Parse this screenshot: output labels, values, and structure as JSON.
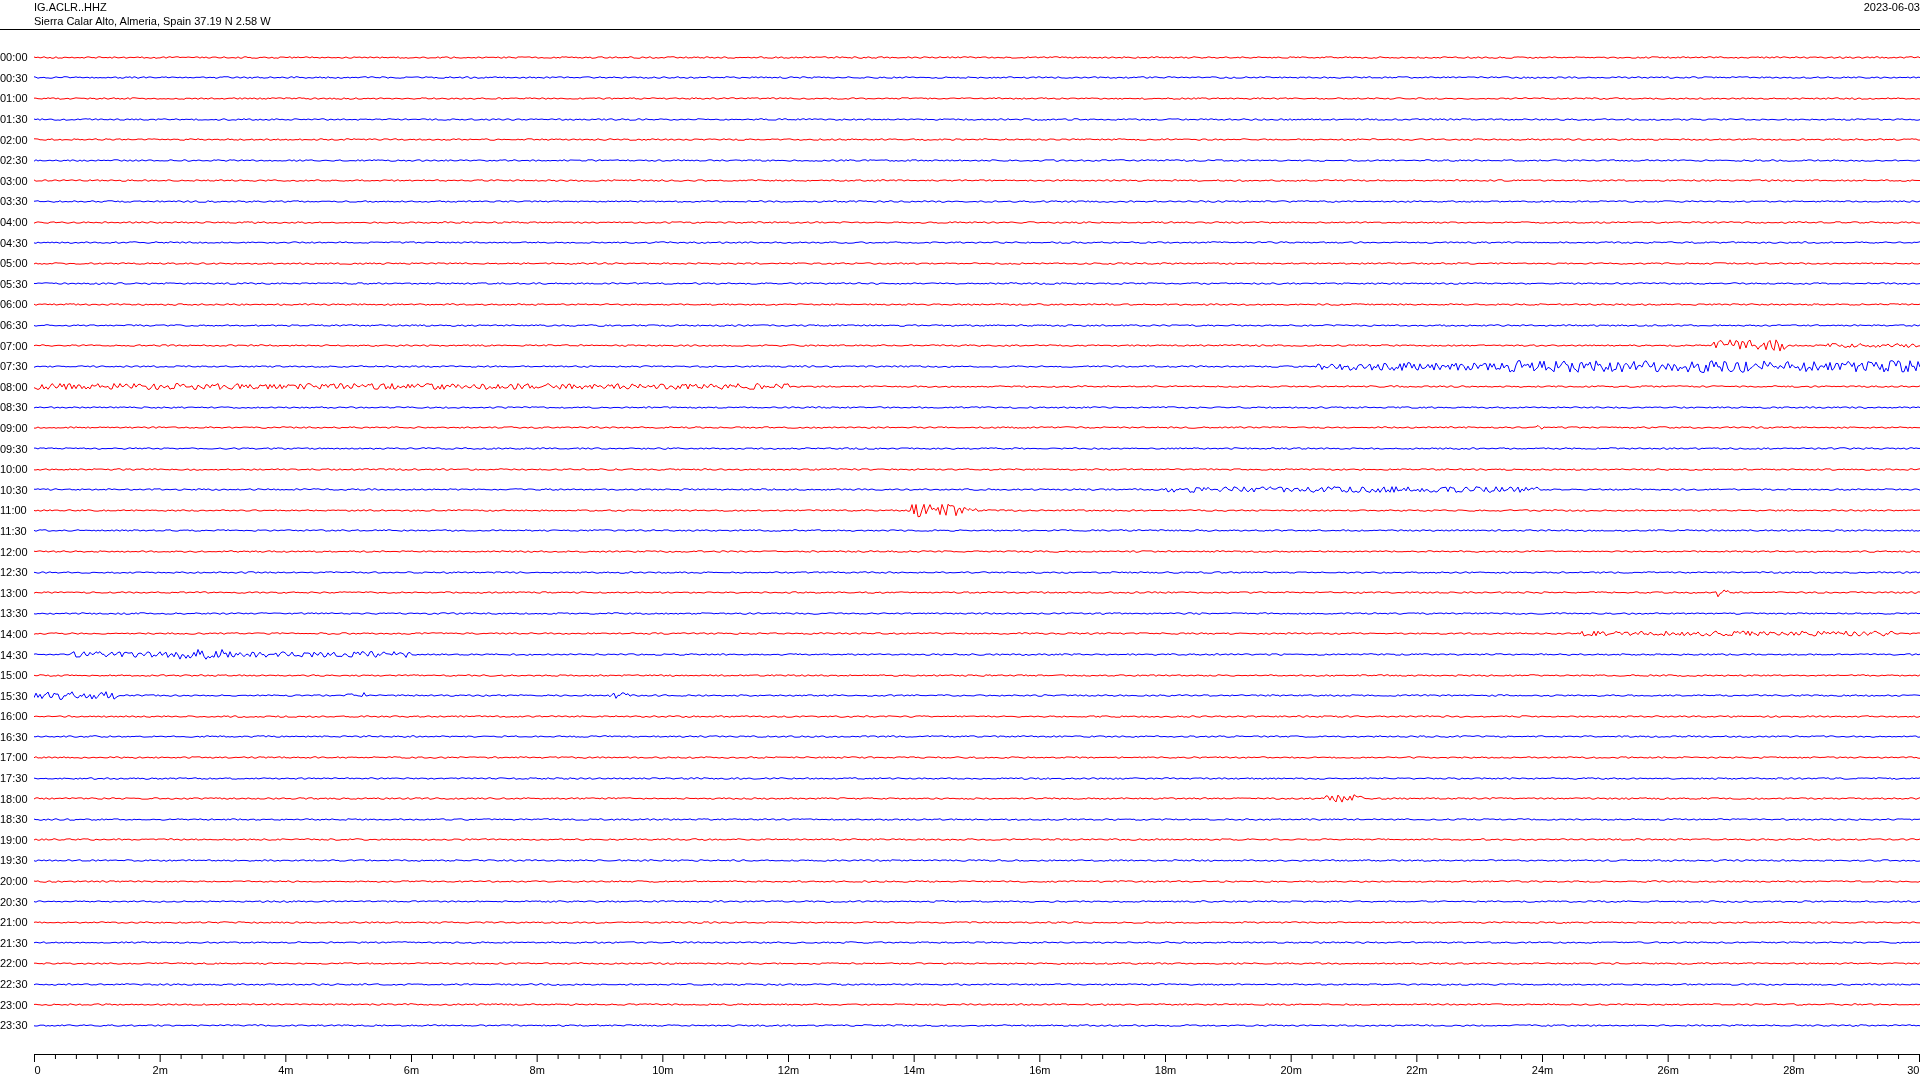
{
  "header": {
    "station": "IG.ACLR..HHZ",
    "location": "Sierra Calar Alto, Almeria, Spain  37.19 N 2.58 W",
    "date": "2023-06-03"
  },
  "traces": [
    {
      "time": "00:00",
      "color": "#ff0000"
    },
    {
      "time": "00:30",
      "color": "#0000ff"
    },
    {
      "time": "01:00",
      "color": "#ff0000"
    },
    {
      "time": "01:30",
      "color": "#0000ff"
    },
    {
      "time": "02:00",
      "color": "#ff0000"
    },
    {
      "time": "02:30",
      "color": "#0000ff"
    },
    {
      "time": "03:00",
      "color": "#ff0000"
    },
    {
      "time": "03:30",
      "color": "#0000ff"
    },
    {
      "time": "04:00",
      "color": "#ff0000"
    },
    {
      "time": "04:30",
      "color": "#0000ff"
    },
    {
      "time": "05:00",
      "color": "#ff0000"
    },
    {
      "time": "05:30",
      "color": "#0000ff"
    },
    {
      "time": "06:00",
      "color": "#ff0000"
    },
    {
      "time": "06:30",
      "color": "#0000ff"
    },
    {
      "time": "07:00",
      "color": "#ff0000"
    },
    {
      "time": "07:30",
      "color": "#0000ff"
    },
    {
      "time": "08:00",
      "color": "#ff0000"
    },
    {
      "time": "08:30",
      "color": "#0000ff"
    },
    {
      "time": "09:00",
      "color": "#ff0000"
    },
    {
      "time": "09:30",
      "color": "#0000ff"
    },
    {
      "time": "10:00",
      "color": "#ff0000"
    },
    {
      "time": "10:30",
      "color": "#0000ff"
    },
    {
      "time": "11:00",
      "color": "#ff0000"
    },
    {
      "time": "11:30",
      "color": "#0000ff"
    },
    {
      "time": "12:00",
      "color": "#ff0000"
    },
    {
      "time": "12:30",
      "color": "#0000ff"
    },
    {
      "time": "13:00",
      "color": "#ff0000"
    },
    {
      "time": "13:30",
      "color": "#0000ff"
    },
    {
      "time": "14:00",
      "color": "#ff0000"
    },
    {
      "time": "14:30",
      "color": "#0000ff"
    },
    {
      "time": "15:00",
      "color": "#ff0000"
    },
    {
      "time": "15:30",
      "color": "#0000ff"
    },
    {
      "time": "16:00",
      "color": "#ff0000"
    },
    {
      "time": "16:30",
      "color": "#0000ff"
    },
    {
      "time": "17:00",
      "color": "#ff0000"
    },
    {
      "time": "17:30",
      "color": "#0000ff"
    },
    {
      "time": "18:00",
      "color": "#ff0000"
    },
    {
      "time": "18:30",
      "color": "#0000ff"
    },
    {
      "time": "19:00",
      "color": "#ff0000"
    },
    {
      "time": "19:30",
      "color": "#0000ff"
    },
    {
      "time": "20:00",
      "color": "#ff0000"
    },
    {
      "time": "20:30",
      "color": "#0000ff"
    },
    {
      "time": "21:00",
      "color": "#ff0000"
    },
    {
      "time": "21:30",
      "color": "#0000ff"
    },
    {
      "time": "22:00",
      "color": "#ff0000"
    },
    {
      "time": "22:30",
      "color": "#0000ff"
    },
    {
      "time": "23:00",
      "color": "#ff0000"
    },
    {
      "time": "23:30",
      "color": "#0000ff"
    }
  ],
  "axis": {
    "labels": [
      "0",
      "2m",
      "4m",
      "6m",
      "8m",
      "10m",
      "12m",
      "14m",
      "16m",
      "18m",
      "20m",
      "22m",
      "24m",
      "26m",
      "28m",
      "30"
    ]
  }
}
